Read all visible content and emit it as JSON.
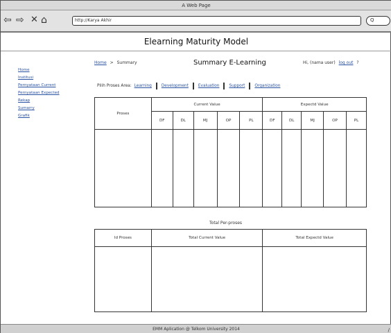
{
  "window": {
    "title": "A Web Page"
  },
  "browser": {
    "back_icon": "left-arrow-icon",
    "forward_icon": "right-arrow-icon",
    "close_icon": "x-icon",
    "home_icon": "house-icon",
    "address": "http://Karya Akhir",
    "search_glyph": "Q"
  },
  "app": {
    "title": "Elearning Maturity Model"
  },
  "sidebar": {
    "items": [
      {
        "label": "Home"
      },
      {
        "label": "Institusi"
      },
      {
        "label": "Pernyataan Current"
      },
      {
        "label": "Pernyataan Expected"
      },
      {
        "label": "Rekap"
      },
      {
        "label": "Sumarry"
      },
      {
        "label": "Grafik"
      }
    ]
  },
  "breadcrumb": {
    "home": "Home",
    "sep": ">",
    "current": "Summary"
  },
  "page": {
    "title": "Summary E-Learning"
  },
  "user": {
    "greeting": "Hi, (nama user)",
    "logout": "log out",
    "help": "?"
  },
  "process_area": {
    "label": "Pilih Proses Area:",
    "items": [
      "Learning",
      "Development",
      "Evaluation",
      "Support",
      "Organization"
    ]
  },
  "table1": {
    "col_proses": "Proses",
    "group_current": "Current Value",
    "group_expected": "Expectd Value",
    "sub_cols": [
      "DF",
      "DL",
      "MJ",
      "OP",
      "PL"
    ]
  },
  "table2": {
    "caption": "Total Per-proses",
    "col_id": "Id Proses",
    "col_current": "Total Current Value",
    "col_expected": "Total Expectd Value"
  },
  "footer": {
    "text": "EMM Aplication @ Telkom University 2014"
  }
}
